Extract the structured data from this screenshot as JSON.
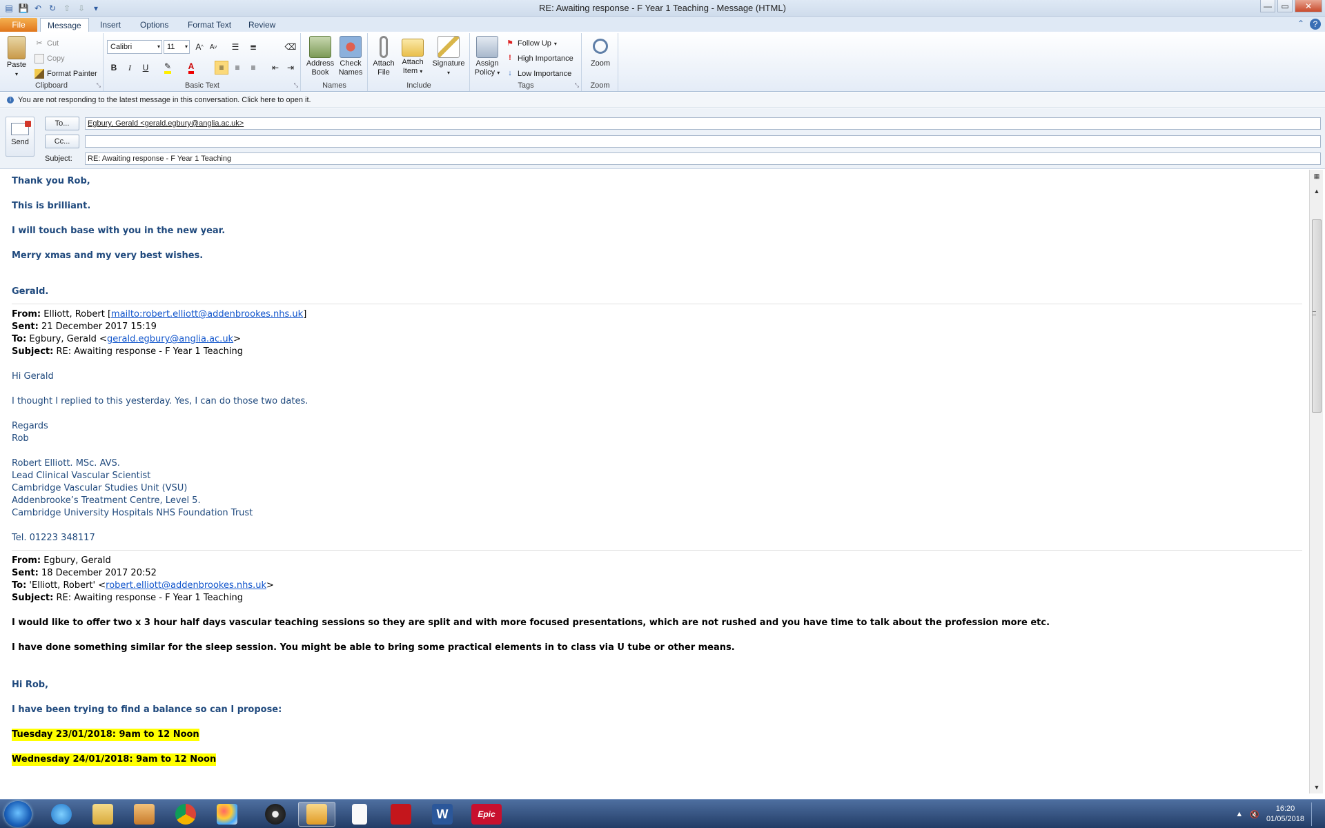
{
  "window": {
    "title": "RE: Awaiting response  - F Year 1 Teaching  -  Message (HTML)"
  },
  "ribbon_tabs": [
    "File",
    "Message",
    "Insert",
    "Options",
    "Format Text",
    "Review"
  ],
  "ribbon": {
    "clipboard": {
      "label": "Clipboard",
      "paste": "Paste",
      "cut": "Cut",
      "copy": "Copy",
      "format_painter": "Format Painter"
    },
    "basic_text": {
      "label": "Basic Text",
      "font": "Calibri",
      "size": "11",
      "bold": "B",
      "italic": "I",
      "underline": "U"
    },
    "names": {
      "label": "Names",
      "address_book": "Address Book",
      "address_book_l1": "Address",
      "address_book_l2": "Book",
      "check_names_l1": "Check",
      "check_names_l2": "Names"
    },
    "include": {
      "label": "Include",
      "attach_file_l1": "Attach",
      "attach_file_l2": "File",
      "attach_item_l1": "Attach",
      "attach_item_l2": "Item",
      "signature": "Signature"
    },
    "tags": {
      "label": "Tags",
      "assign_policy_l1": "Assign",
      "assign_policy_l2": "Policy",
      "follow_up": "Follow Up",
      "high_importance": "High Importance",
      "low_importance": "Low Importance"
    },
    "zoom": {
      "label": "Zoom",
      "zoom": "Zoom"
    }
  },
  "infobar": {
    "text": "You are not responding to the latest message in this conversation. Click here to open it."
  },
  "header": {
    "send": "Send",
    "to_button": "To...",
    "cc_button": "Cc...",
    "subject_label": "Subject:",
    "to_value": "Egbury, Gerald <gerald.egbury@anglia.ac.uk>",
    "cc_value": "",
    "subject_value": "RE: Awaiting response  - F Year 1 Teaching"
  },
  "body": {
    "reply": [
      "Thank you Rob,",
      "This is brilliant.",
      "I will touch base with you in the new year.",
      "Merry xmas and my very best wishes.",
      "Gerald."
    ],
    "msg1": {
      "from_label": "From:",
      "from_name": " Elliott, Robert [",
      "from_link": "mailto:robert.elliott@addenbrookes.nhs.uk",
      "from_end": "]",
      "sent_label": "Sent:",
      "sent": " 21 December 2017 15:19",
      "to_label": "To:",
      "to_name": " Egbury, Gerald <",
      "to_link": "gerald.egbury@anglia.ac.uk",
      "to_end": ">",
      "subject_label": "Subject:",
      "subject": " RE: Awaiting response - F Year 1 Teaching",
      "greeting": "Hi Gerald",
      "text": "I thought I replied to this yesterday. Yes, I can do those two dates.",
      "regards": "Regards",
      "name": "Rob",
      "sig": [
        "Robert Elliott. MSc. AVS.",
        "Lead Clinical Vascular Scientist",
        "Cambridge Vascular Studies Unit (VSU)",
        "Addenbrooke’s Treatment Centre, Level 5.",
        "Cambridge University Hospitals NHS Foundation Trust"
      ],
      "tel": "Tel. 01223 348117"
    },
    "msg2": {
      "from_label": "From:",
      "from": " Egbury, Gerald",
      "sent_label": "Sent:",
      "sent": " 18 December 2017 20:52",
      "to_label": "To:",
      "to_name": " 'Elliott, Robert' <",
      "to_link": "robert.elliott@addenbrookes.nhs.uk",
      "to_end": ">",
      "subject_label": "Subject:",
      "subject": " RE: Awaiting response - F Year 1 Teaching",
      "p1": "I would like to offer two x 3 hour half days vascular teaching sessions so they are split and with more focused presentations, which are not rushed and you have time to talk about the profession more etc.",
      "p2": "I have done something similar for the sleep session. You might be able to bring some practical elements in to class via U tube or other means.",
      "greeting": "Hi Rob,",
      "propose": "I have been trying to find a balance so can I propose:",
      "date1": "Tuesday   23/01/2018:  9am to 12 Noon",
      "date2": "Wednesday 24/01/2018:  9am to 12 Noon"
    }
  },
  "taskbar": {
    "time": "16:20",
    "date": "01/05/2018",
    "epic_label": "Epic",
    "word_label": "W"
  }
}
